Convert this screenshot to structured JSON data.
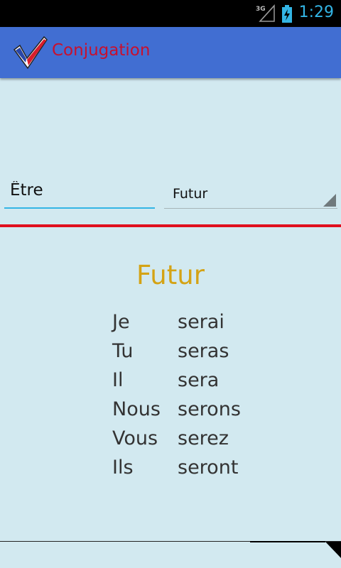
{
  "status_bar": {
    "network": "3G",
    "time": "1:29"
  },
  "app": {
    "title": "Conjugation",
    "brand_color": "#c8102e",
    "bar_color": "#416ed2"
  },
  "form": {
    "verb_value": "Être",
    "tense_selected": "Futur"
  },
  "result": {
    "heading": "Futur",
    "rows": [
      {
        "pronoun": "Je",
        "form": "serai"
      },
      {
        "pronoun": "Tu",
        "form": "seras"
      },
      {
        "pronoun": "Il",
        "form": "sera"
      },
      {
        "pronoun": "Nous",
        "form": "serons"
      },
      {
        "pronoun": "Vous",
        "form": "serez"
      },
      {
        "pronoun": "Ils",
        "form": "seront"
      }
    ]
  },
  "icons": {
    "signal": "signal-3g-icon",
    "battery": "battery-charging-icon",
    "logo": "checkmark-logo-icon",
    "dropdown": "dropdown-caret-icon"
  }
}
